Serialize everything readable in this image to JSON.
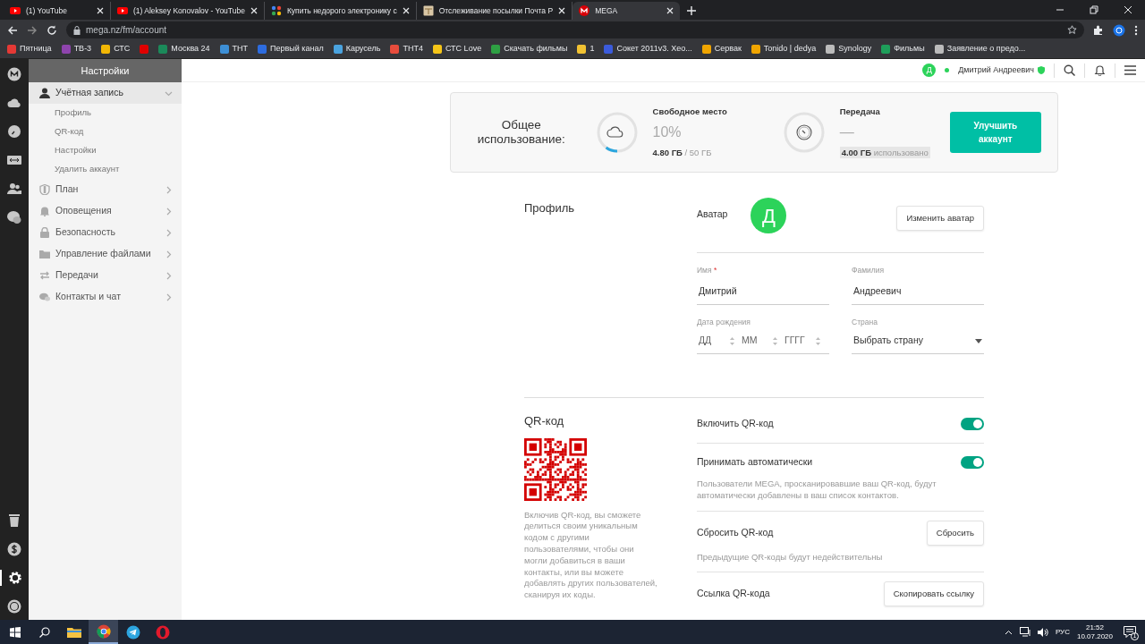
{
  "browser": {
    "tabs": [
      {
        "title": "(1) YouTube",
        "kind": "youtube",
        "selected": false
      },
      {
        "title": "(1) Aleksey Konovalov - YouTube",
        "kind": "youtube",
        "selected": false
      },
      {
        "title": "Купить недорого электронику с",
        "kind": "dots",
        "selected": false
      },
      {
        "title": "Отслеживание посылки Почта Р",
        "kind": "parcel",
        "selected": false
      },
      {
        "title": "MEGA",
        "kind": "mega",
        "selected": true
      }
    ],
    "address": "mega.nz/fm/account",
    "bookmarks": [
      {
        "label": "Пятница",
        "color": "#e53935"
      },
      {
        "label": "ТВ-3",
        "color": "#8e44ad"
      },
      {
        "label": "СТС",
        "color": "#f2b705"
      },
      {
        "color": "#e00000"
      },
      {
        "label": "Москва 24",
        "color": "#1b8a5a"
      },
      {
        "label": "ТНТ",
        "color": "#3d8fd6"
      },
      {
        "label": "Первый канал",
        "color": "#2d6cdf"
      },
      {
        "label": "Карусель",
        "color": "#4aa3df"
      },
      {
        "label": "ТНТ4",
        "color": "#e74c3c"
      },
      {
        "label": "СТС Love",
        "color": "#f5c518"
      },
      {
        "label": "Скачать фильмы",
        "color": "#2ea043"
      },
      {
        "label": "1",
        "color": "#f1c232"
      },
      {
        "label": "Сокет 2011v3. Xeo...",
        "color": "#3b5bdb"
      },
      {
        "label": "Сервак",
        "color": "#f0a500"
      },
      {
        "label": "Tonido | dedya",
        "color": "#f0a500"
      },
      {
        "label": "Synology",
        "color": "#bbbbbb"
      },
      {
        "label": "Фильмы",
        "color": "#1e9e5a"
      },
      {
        "label": "Заявление о предо...",
        "color": "#bbbbbb"
      }
    ]
  },
  "rail": {
    "top": [
      {
        "kind": "logo",
        "selected": false
      },
      {
        "kind": "cloud",
        "selected": false
      },
      {
        "kind": "clock",
        "selected": false
      },
      {
        "kind": "transfer",
        "selected": false
      },
      {
        "kind": "contacts",
        "selected": false
      },
      {
        "kind": "chat",
        "selected": false
      }
    ],
    "bottom": [
      {
        "kind": "trash",
        "selected": false
      },
      {
        "kind": "dollar",
        "selected": false
      },
      {
        "kind": "gear",
        "selected": true
      },
      {
        "kind": "badge",
        "selected": false
      }
    ]
  },
  "sidebar": {
    "title": "Настройки",
    "items": [
      {
        "label": "Учётная запись",
        "kind": "person",
        "expanded": true,
        "children": [
          {
            "label": "Профиль"
          },
          {
            "label": "QR-код"
          },
          {
            "label": "Настройки"
          },
          {
            "label": "Удалить аккаунт"
          }
        ]
      },
      {
        "label": "План",
        "kind": "shield",
        "expanded": false
      },
      {
        "label": "Оповещения",
        "kind": "bell",
        "expanded": false
      },
      {
        "label": "Безопасность",
        "kind": "lock",
        "expanded": false
      },
      {
        "label": "Управление файлами",
        "kind": "folder",
        "expanded": false
      },
      {
        "label": "Передачи",
        "kind": "arrows",
        "expanded": false
      },
      {
        "label": "Контакты и чат",
        "kind": "chat",
        "expanded": false
      }
    ]
  },
  "topbar": {
    "avatar_letter": "Д",
    "online": true,
    "user_name": "Дмитрий Андреевич"
  },
  "usage": {
    "title": "Общее использование:",
    "storage": {
      "label": "Свободное место",
      "percent": "10%",
      "used": "4.80 ГБ",
      "total": "/ 50 ГБ",
      "level": 0.1
    },
    "transfer": {
      "label": "Передача",
      "dash": "—",
      "used": "4.00 ГБ",
      "used_label": "использовано"
    },
    "upgrade_button": "Улучшить аккаунт"
  },
  "profile": {
    "heading": "Профиль",
    "avatar_label": "Аватар",
    "avatar_letter": "Д",
    "change_avatar_button": "Изменить аватар",
    "fields": [
      {
        "label": "Имя",
        "required_mark": "*",
        "value": "Дмитрий"
      },
      {
        "label": "Фамилия",
        "value": "Андреевич"
      }
    ],
    "birth": {
      "label": "Дата рождения",
      "placeholders": [
        "ДД",
        "ММ",
        "ГГГГ"
      ]
    },
    "country": {
      "label": "Страна",
      "value": "Выбрать страну"
    }
  },
  "qr": {
    "heading": "QR-код",
    "description": "Включив QR-код, вы сможете делиться своим уникальным кодом с другими пользователями, чтобы они могли добавиться в ваши контакты, или вы можете добавлять других пользователей, сканируя их коды.",
    "settings": [
      {
        "kind": "toggle",
        "label": "Включить QR-код",
        "on": true
      },
      {
        "kind": "toggle",
        "label": "Принимать автоматически",
        "on": true,
        "note": "Пользователи MEGA, просканировавшие ваш QR-код, будут автоматически добавлены в ваш список контактов."
      },
      {
        "kind": "button",
        "label": "Сбросить QR-код",
        "button": "Сбросить",
        "note": "Предыдущие QR-коды будут недействительны"
      },
      {
        "kind": "button",
        "label": "Ссылка QR-кода",
        "button": "Скопировать ссылку"
      }
    ]
  },
  "taskbar": {
    "apps": [
      {
        "kind": "explorer",
        "selected": false
      },
      {
        "kind": "chrome",
        "selected": true
      },
      {
        "kind": "telegram",
        "selected": false
      },
      {
        "kind": "opera",
        "selected": false
      }
    ],
    "language": "РУС",
    "time": "21:52",
    "date": "10.07.2020",
    "notifications": "1"
  }
}
